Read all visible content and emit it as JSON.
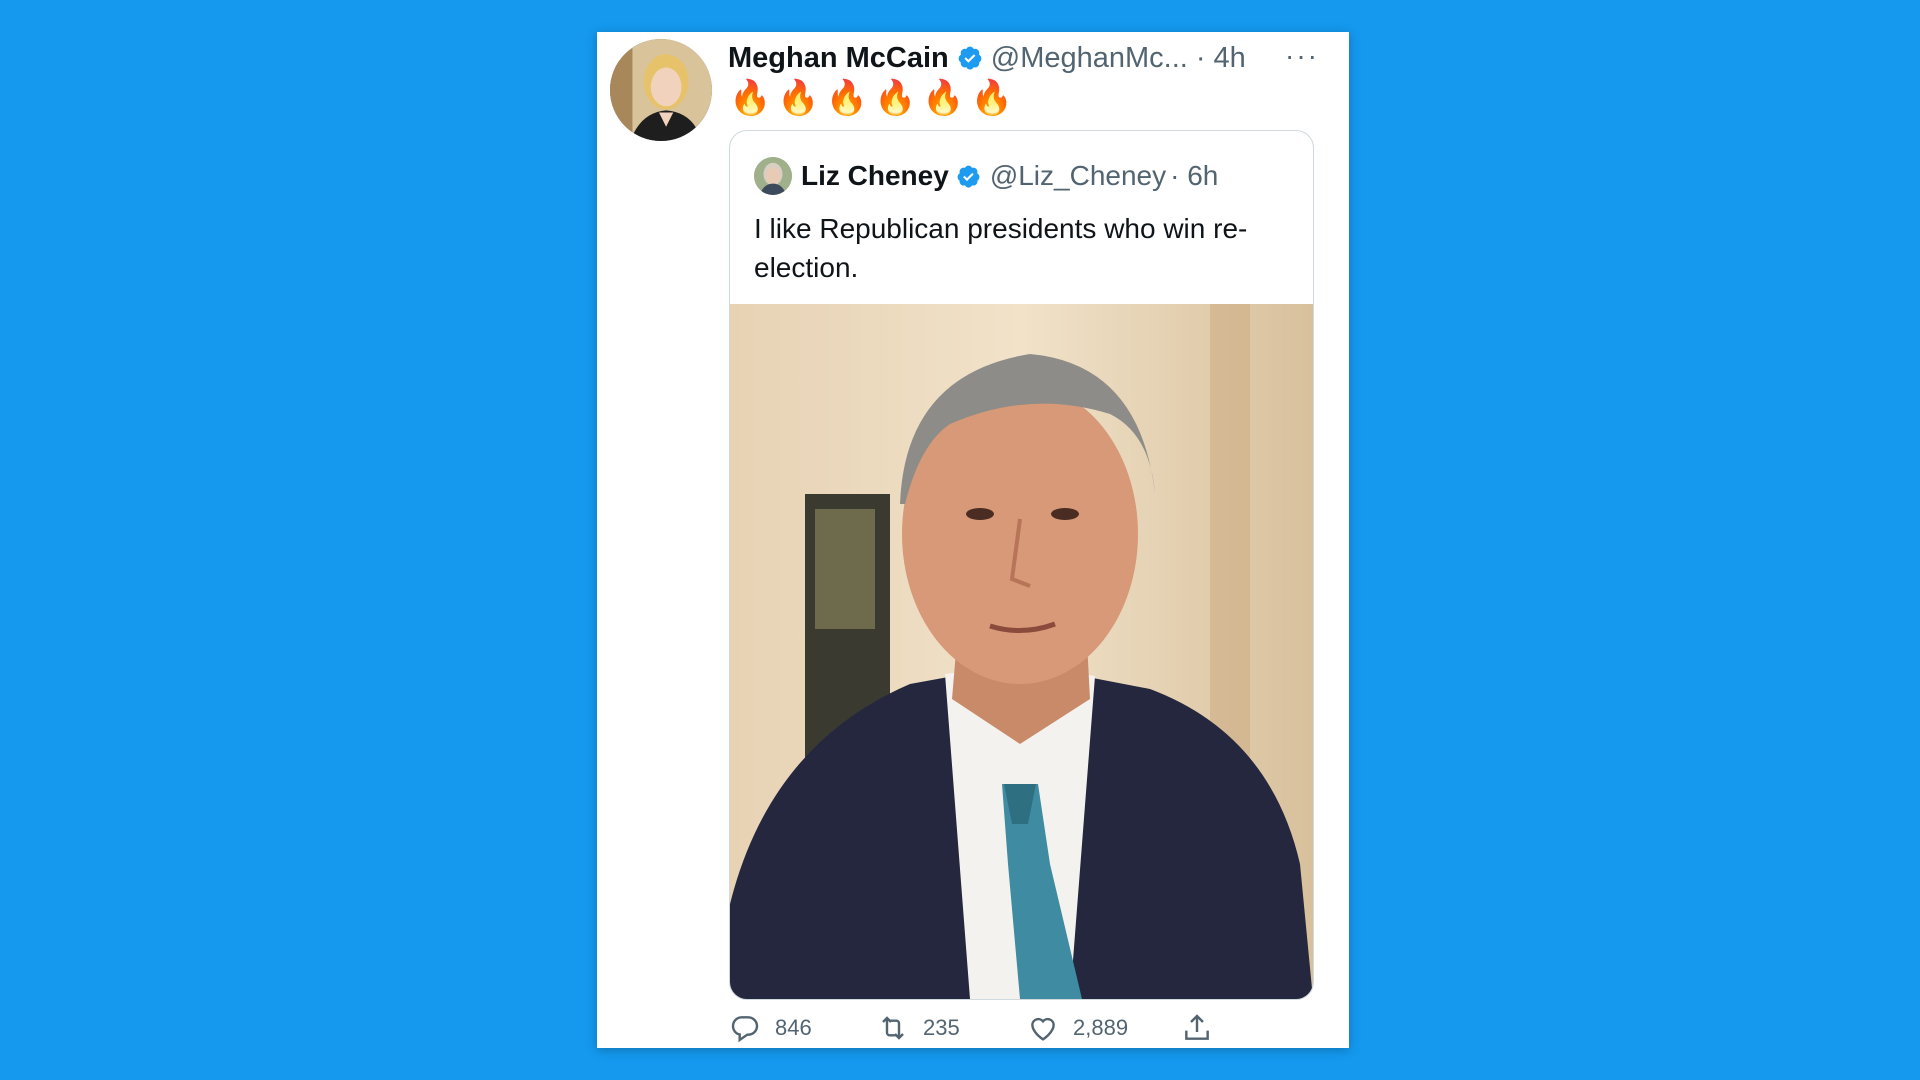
{
  "tweet": {
    "author_name": "Meghan McCain",
    "author_handle": "@MeghanMc...",
    "time": "· 4h",
    "more": "···",
    "text": "🔥🔥🔥🔥🔥🔥",
    "stats": {
      "replies": "846",
      "retweets": "235",
      "likes": "2,889"
    }
  },
  "quoted": {
    "author_name": "Liz Cheney",
    "author_handle": "@Liz_Cheney",
    "time": "· 6h",
    "text": "I like Republican presidents who win re-election."
  },
  "icons": {
    "verified": "verified-badge-icon",
    "reply": "reply-icon",
    "retweet": "retweet-icon",
    "like": "heart-icon",
    "share": "share-icon"
  },
  "colors": {
    "background": "#1499ef",
    "verified": "#1d9bf0",
    "muted": "#536471"
  }
}
